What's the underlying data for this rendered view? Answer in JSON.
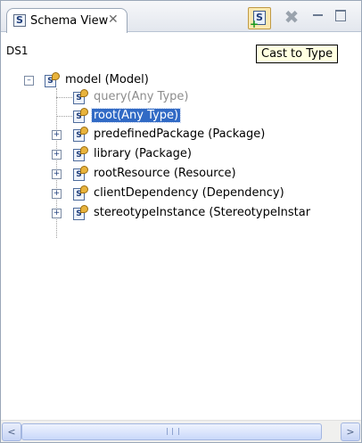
{
  "view": {
    "tab_icon": "S",
    "tab_title": "Schema View",
    "tab_close_glyph": "✕",
    "toolbar": {
      "cast_button_icon": "schema-add-icon",
      "remove_button_icon": "remove-icon",
      "minimize_icon": "minimize-icon",
      "maximize_icon": "maximize-icon"
    }
  },
  "datasource": "DS1",
  "tooltip": "Cast to Type",
  "tree": {
    "root": {
      "label": "model (Model)",
      "expanded": true
    },
    "children": [
      {
        "label": "query(Any Type)",
        "style": "dim",
        "expandable": false
      },
      {
        "label": "root(Any Type)",
        "style": "selected",
        "expandable": false
      },
      {
        "label": "predefinedPackage (Package)",
        "style": "normal",
        "expandable": true
      },
      {
        "label": "library (Package)",
        "style": "normal",
        "expandable": true
      },
      {
        "label": "rootResource (Resource)",
        "style": "normal",
        "expandable": true
      },
      {
        "label": "clientDependency (Dependency)",
        "style": "normal",
        "expandable": true
      },
      {
        "label": "stereotypeInstance (StereotypeInstar",
        "style": "normal",
        "expandable": true
      }
    ]
  },
  "scrollbar": {
    "left_arrow": "<",
    "right_arrow": ">"
  },
  "colors": {
    "selection": "#316ac5",
    "dim_text": "#8c8c8c",
    "tooltip_bg": "#ffffe1"
  }
}
